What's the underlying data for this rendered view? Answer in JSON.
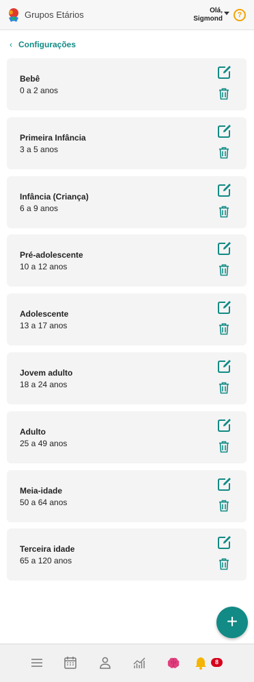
{
  "header": {
    "title": "Grupos Etários",
    "greeting": "Olá,",
    "user_name": "Sigmond",
    "help_symbol": "?"
  },
  "back": {
    "label": "Configurações"
  },
  "age_groups": [
    {
      "name": "Bebê",
      "range": "0 a 2 anos"
    },
    {
      "name": "Primeira Infância",
      "range": "3 a 5 anos"
    },
    {
      "name": "Infância (Criança)",
      "range": "6 a 9 anos"
    },
    {
      "name": "Pré-adolescente",
      "range": "10 a 12 anos"
    },
    {
      "name": "Adolescente",
      "range": "13 a 17 anos"
    },
    {
      "name": "Jovem adulto",
      "range": "18 a 24 anos"
    },
    {
      "name": "Adulto",
      "range": "25 a 49 anos"
    },
    {
      "name": "Meia-idade",
      "range": "50 a 64 anos"
    },
    {
      "name": "Terceira idade",
      "range": "65 a 120 anos"
    }
  ],
  "fab": {
    "symbol": "+"
  },
  "bottom_nav": {
    "items": [
      {
        "icon": "menu-icon"
      },
      {
        "icon": "calendar-icon"
      },
      {
        "icon": "person-icon"
      },
      {
        "icon": "chart-icon"
      },
      {
        "icon": "brain-icon"
      },
      {
        "icon": "bell-icon"
      }
    ],
    "notification_count": "8"
  },
  "colors": {
    "accent": "#128a85",
    "warning": "#f5a200",
    "badge": "#d6001c",
    "brain": "#e0407f",
    "bell": "#f5b400"
  }
}
